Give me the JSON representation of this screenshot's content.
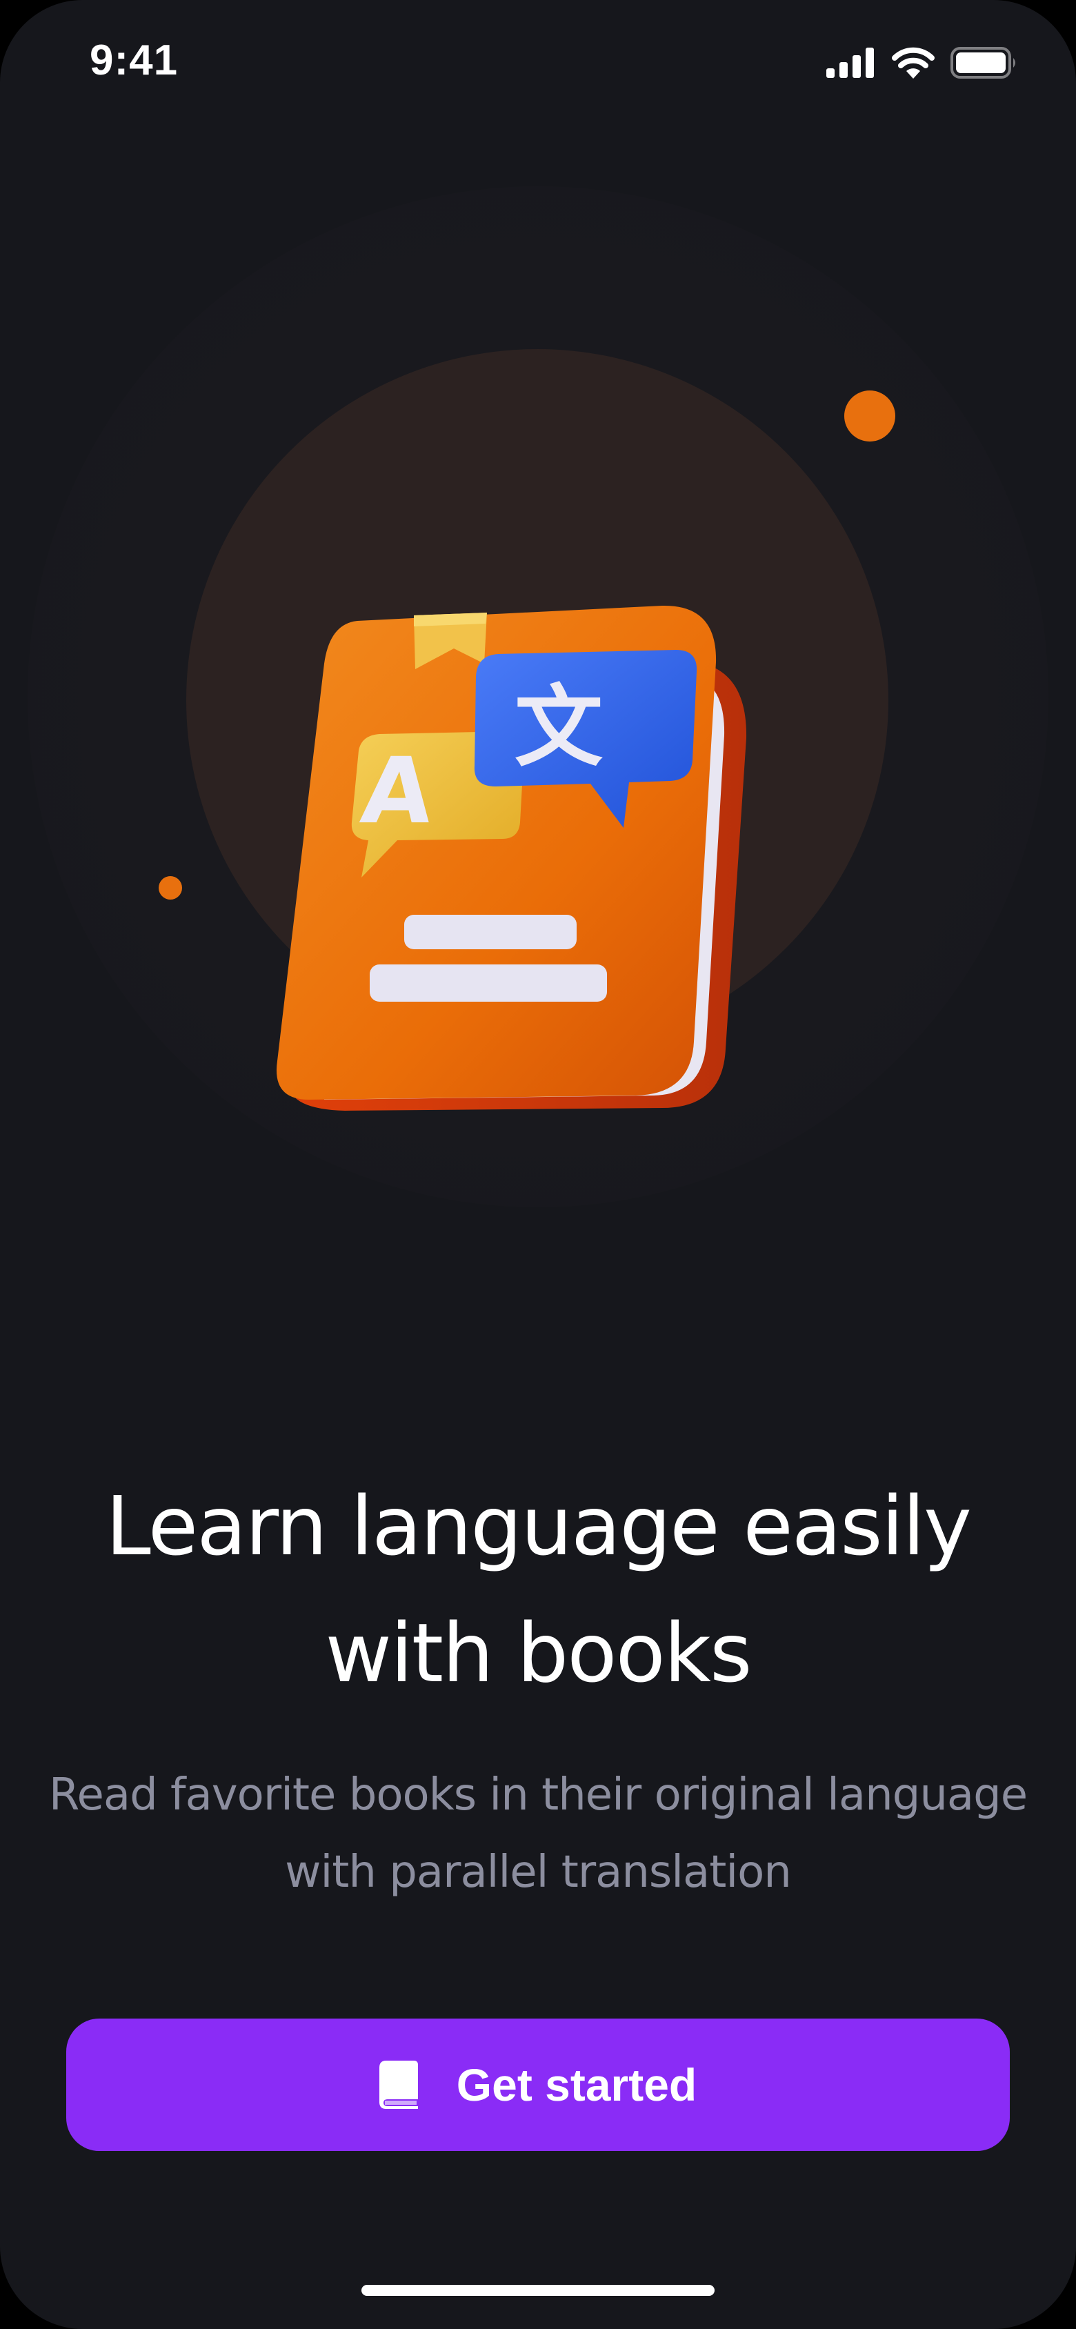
{
  "status_bar": {
    "time": "9:41",
    "icons": [
      "cellular-signal-icon",
      "wifi-icon",
      "battery-icon"
    ]
  },
  "hero": {
    "illustration": "translate-book-illustration",
    "illustration_glyphs": [
      "A",
      "文"
    ],
    "colors": {
      "accent_orange": "#e8700e",
      "halo": "#2c2221"
    }
  },
  "onboarding": {
    "title_line1": "Learn language easily",
    "title_line2": "with books",
    "subtitle_line1": "Read favorite books in their original language",
    "subtitle_line2": "with parallel translation"
  },
  "cta": {
    "label": "Get started",
    "icon": "book-icon",
    "color": "#8a2cf6"
  },
  "theme": {
    "background": "#16171c",
    "text_primary": "#ffffff",
    "text_secondary": "#8c8e9f"
  }
}
